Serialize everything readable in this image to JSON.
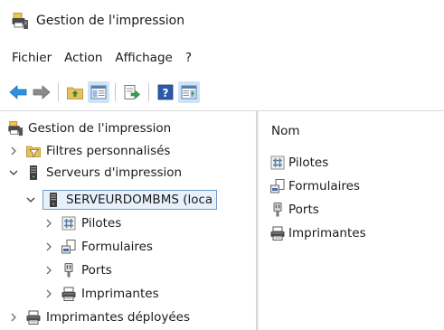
{
  "window": {
    "title": "Gestion de l'impression",
    "icon": "printer-management-icon"
  },
  "menubar": {
    "items": [
      "Fichier",
      "Action",
      "Affichage",
      "?"
    ]
  },
  "toolbar": {
    "buttons": [
      {
        "icon": "back-arrow-icon"
      },
      {
        "icon": "forward-arrow-icon"
      },
      {
        "icon": "folder-up-icon"
      },
      {
        "icon": "show-hide-console-tree-icon",
        "active": true
      },
      {
        "icon": "export-list-icon"
      },
      {
        "icon": "help-icon"
      },
      {
        "icon": "show-hide-action-pane-icon",
        "active": true
      }
    ]
  },
  "tree": {
    "root": "Gestion de l'impression",
    "items": [
      {
        "label": "Filtres personnalisés",
        "icon": "filter-folder-icon",
        "expanded": false
      },
      {
        "label": "Serveurs d'impression",
        "icon": "server-icon",
        "expanded": true
      },
      {
        "label": "SERVEURDOMBMS (loca",
        "icon": "server-icon",
        "expanded": true,
        "selected": true
      },
      {
        "label": "Pilotes",
        "icon": "driver-icon",
        "expanded": false
      },
      {
        "label": "Formulaires",
        "icon": "forms-icon",
        "expanded": false
      },
      {
        "label": "Ports",
        "icon": "port-icon",
        "expanded": false
      },
      {
        "label": "Imprimantes",
        "icon": "printer-icon",
        "expanded": false
      },
      {
        "label": "Imprimantes déployées",
        "icon": "printer-icon",
        "expanded": false
      }
    ]
  },
  "list": {
    "column_header": "Nom",
    "items": [
      {
        "label": "Pilotes",
        "icon": "driver-icon"
      },
      {
        "label": "Formulaires",
        "icon": "forms-icon"
      },
      {
        "label": "Ports",
        "icon": "port-icon"
      },
      {
        "label": "Imprimantes",
        "icon": "printer-icon"
      }
    ]
  },
  "colors": {
    "selection_border": "#6c9bd1",
    "selection_fill": "#e8f1fb",
    "toolbar_active": "#cce4f7"
  }
}
